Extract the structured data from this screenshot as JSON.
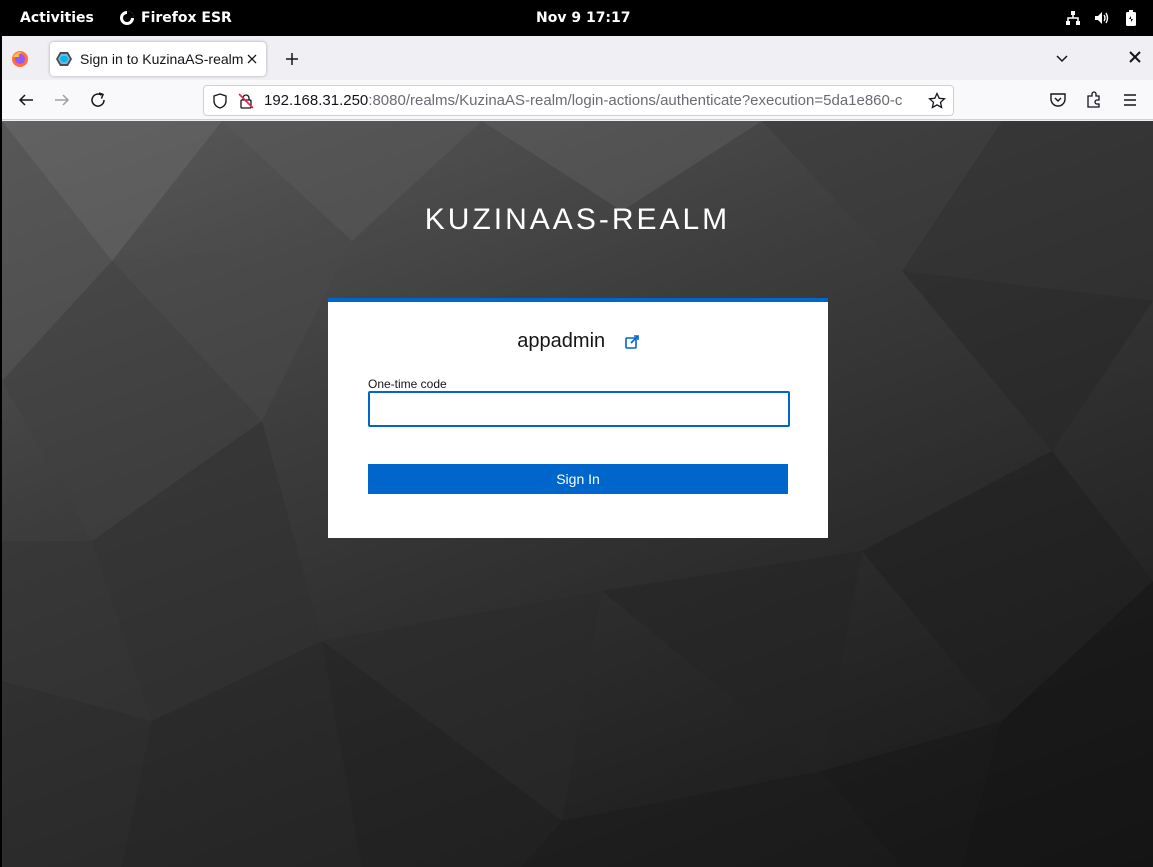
{
  "topbar": {
    "activities": "Activities",
    "app_name": "Firefox ESR",
    "clock": "Nov 9  17:17"
  },
  "browser": {
    "tab_title": "Sign in to KuzinaAS-realm",
    "url_host": "192.168.31.250",
    "url_rest": ":8080/realms/KuzinaAS-realm/login-actions/authenticate?execution=5da1e860-c"
  },
  "page": {
    "realm_title": "KUZINAAS-REALM",
    "username": "appadmin",
    "otp_label": "One-time code",
    "otp_value": "",
    "signin_label": "Sign In"
  },
  "colors": {
    "accent": "#0066cc",
    "topbar": "#000000",
    "tabbar": "#f0f0f4"
  }
}
